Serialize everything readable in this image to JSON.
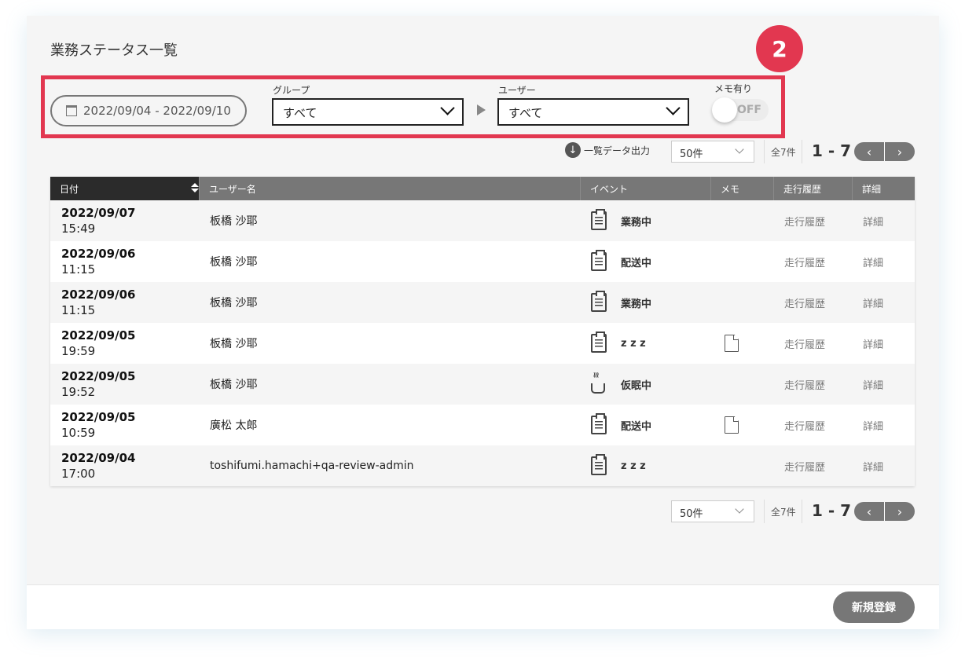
{
  "page": {
    "title": "業務ステータス一覧",
    "step_badge": "2"
  },
  "filters": {
    "date_range": "2022/09/04 - 2022/09/10",
    "group_label": "グループ",
    "group_value": "すべて",
    "user_label": "ユーザー",
    "user_value": "すべて",
    "memo_label": "メモ有り",
    "memo_toggle": "OFF"
  },
  "toolbar": {
    "export_label": "一覧データ出力",
    "per_page": "50件",
    "total": "全7件",
    "range": "1 - 7",
    "prev": "‹",
    "next": "›"
  },
  "table": {
    "headers": [
      "日付",
      "ユーザー名",
      "イベント",
      "メモ",
      "走行履歴",
      "詳細"
    ],
    "rows": [
      {
        "date": "2022/09/07",
        "time": "15:49",
        "user": "板橋 沙耶",
        "event_icon": "clipboard-icon",
        "event": "業務中",
        "memo": false,
        "run": "走行履歴",
        "detail": "詳細"
      },
      {
        "date": "2022/09/06",
        "time": "11:15",
        "user": "板橋 沙耶",
        "event_icon": "clipboard-icon",
        "event": "配送中",
        "memo": false,
        "run": "走行履歴",
        "detail": "詳細"
      },
      {
        "date": "2022/09/06",
        "time": "11:15",
        "user": "板橋 沙耶",
        "event_icon": "clipboard-icon",
        "event": "業務中",
        "memo": false,
        "run": "走行履歴",
        "detail": "詳細"
      },
      {
        "date": "2022/09/05",
        "time": "19:59",
        "user": "板橋 沙耶",
        "event_icon": "clipboard-icon",
        "event": "z z z",
        "memo": true,
        "run": "走行履歴",
        "detail": "詳細"
      },
      {
        "date": "2022/09/05",
        "time": "19:52",
        "user": "板橋 沙耶",
        "event_icon": "coffee-cup-icon",
        "event": "仮眠中",
        "memo": false,
        "run": "走行履歴",
        "detail": "詳細"
      },
      {
        "date": "2022/09/05",
        "time": "10:59",
        "user": "廣松 太郎",
        "event_icon": "clipboard-icon",
        "event": "配送中",
        "memo": true,
        "run": "走行履歴",
        "detail": "詳細"
      },
      {
        "date": "2022/09/04",
        "time": "17:00",
        "user": "toshifumi.hamachi+qa-review-admin",
        "event_icon": "clipboard-icon",
        "event": "z z z",
        "memo": false,
        "run": "走行履歴",
        "detail": "詳細"
      }
    ]
  },
  "footer": {
    "register_button": "新規登録"
  },
  "colors": {
    "highlight": "#e23750",
    "header_dark": "#2b2b2b",
    "header": "#777777"
  }
}
